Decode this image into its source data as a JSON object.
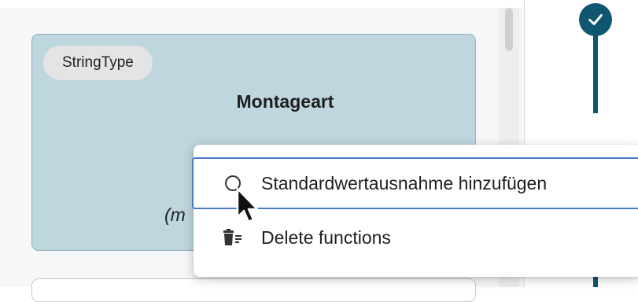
{
  "card": {
    "type_chip": "StringType",
    "title": "Montageart",
    "note": "(m"
  },
  "context_menu": {
    "items": [
      {
        "label": "Standardwertausnahme hinzufügen",
        "icon": "circle-outline-icon"
      },
      {
        "label": "Delete functions",
        "icon": "trash-list-icon"
      }
    ]
  },
  "timeline": {
    "status_icon": "check-icon",
    "accent_color": "#0f5670"
  },
  "colors": {
    "card_background": "#bed6de",
    "menu_focus_border": "#4a7ac4"
  }
}
